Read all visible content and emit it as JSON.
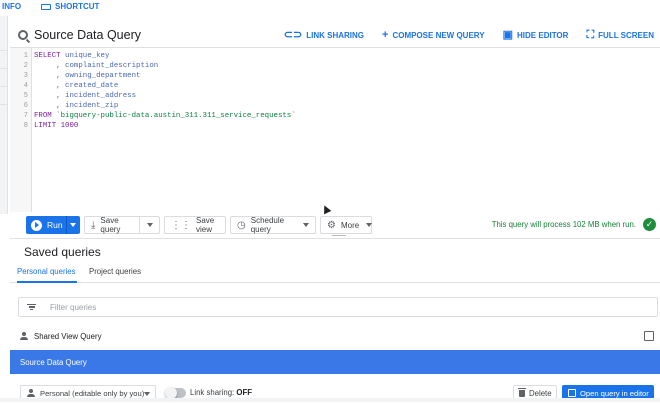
{
  "topbar": {
    "info_label": "INFO",
    "shortcut_label": "SHORTCUT",
    "shortcut_icon": "keyboard-icon"
  },
  "editor_header": {
    "title": "Source Data Query",
    "title_icon": "query-icon",
    "actions": {
      "link_sharing": "LINK SHARING",
      "compose_new_query": "COMPOSE NEW QUERY",
      "hide_editor": "HIDE EDITOR",
      "full_screen": "FULL SCREEN"
    }
  },
  "editor": {
    "line_numbers": [
      "1",
      "2",
      "3",
      "4",
      "5",
      "6",
      "7",
      "8"
    ],
    "lines": [
      {
        "kw": "SELECT",
        "rest": " unique_key"
      },
      {
        "kw": "",
        "rest": "     , complaint_description"
      },
      {
        "kw": "",
        "rest": "     , owning_department"
      },
      {
        "kw": "",
        "rest": "     , created_date"
      },
      {
        "kw": "",
        "rest": "     , incident_address"
      },
      {
        "kw": "",
        "rest": "     , incident_zip"
      },
      {
        "kw": "FROM",
        "rest": " `bigquery-public-data.austin_311.311_service_requests`"
      },
      {
        "kw": "LIMIT",
        "rest": " 1000"
      }
    ]
  },
  "toolbar": {
    "run_label": "Run",
    "save_query_label": "Save query",
    "save_view_label": "Save view",
    "schedule_query_label": "Schedule query",
    "more_label": "More",
    "status_text": "This query will process 102 MB when run.",
    "status_color": "#188038"
  },
  "saved": {
    "title": "Saved queries",
    "tabs": [
      "Personal queries",
      "Project queries"
    ],
    "filter_placeholder": "Filter queries",
    "rows": [
      {
        "label": "Shared View Query"
      },
      {
        "label": "Source Data Query"
      }
    ],
    "visibility_dropdown": "Personal (editable only by you)",
    "link_sharing_label": "Link sharing:",
    "link_sharing_state": "OFF",
    "delete_label": "Delete",
    "open_label": "Open query in editor"
  },
  "colors": {
    "accent": "#1a73e8",
    "selected_row": "#3b78e7"
  }
}
